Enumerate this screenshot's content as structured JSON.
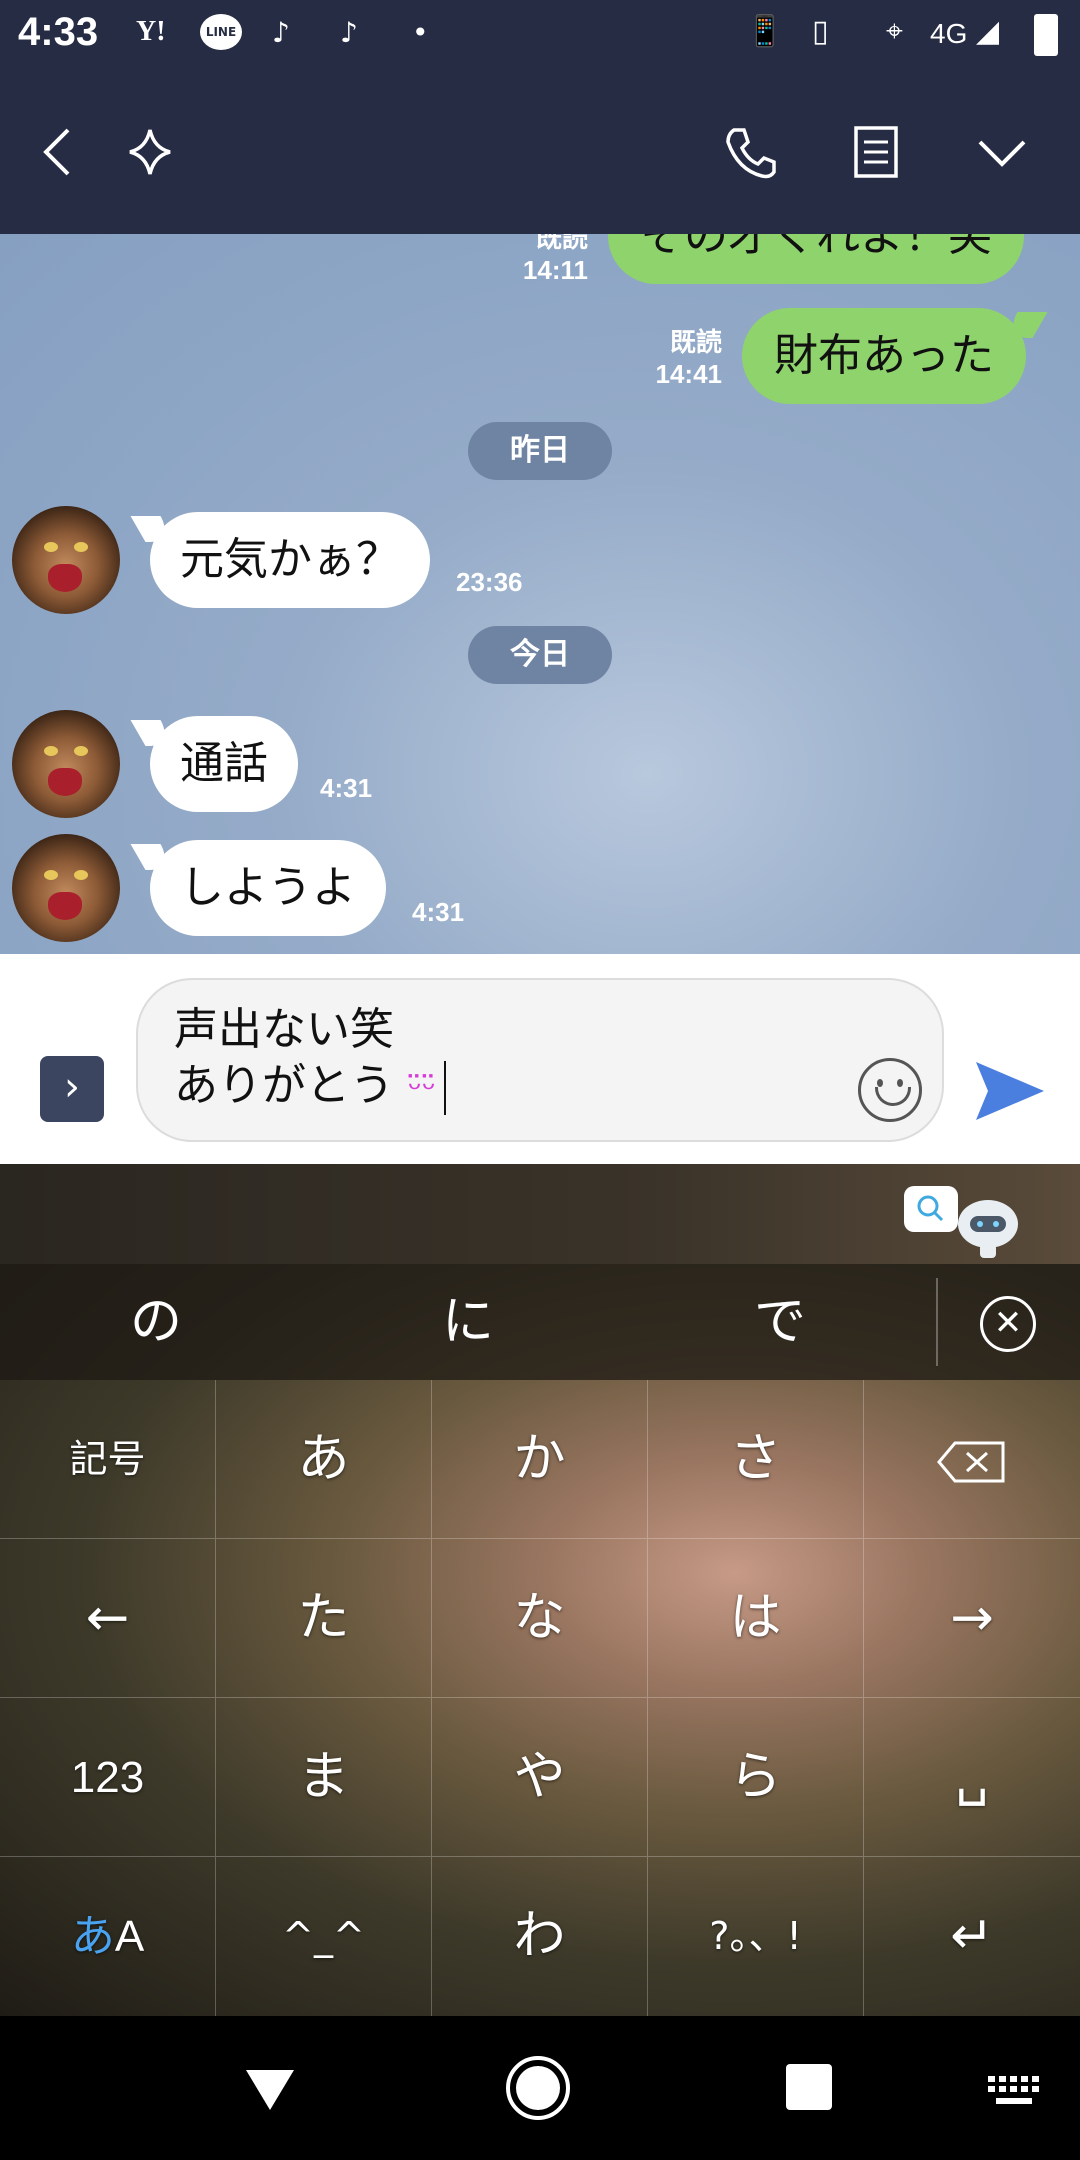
{
  "status_bar": {
    "time": "4:33",
    "left_icons": [
      "Y!",
      "LINE",
      "tiktok-icon",
      "tiktok-icon",
      "•"
    ],
    "network": "4G"
  },
  "header": {
    "back_icon": "chevron-left-icon",
    "star_icon": "sparkle-icon",
    "call_icon": "phone-icon",
    "notes_icon": "notes-icon",
    "menu_icon": "chevron-down-icon"
  },
  "messages": [
    {
      "side": "out",
      "text": "その才くれよ！笑",
      "read": "既読",
      "time": "14:11"
    },
    {
      "side": "out",
      "text": "財布あった",
      "read": "既読",
      "time": "14:41"
    },
    {
      "side": "divider",
      "text": "昨日"
    },
    {
      "side": "in",
      "text": "元気かぁ？",
      "time": "23:36"
    },
    {
      "side": "divider",
      "text": "今日"
    },
    {
      "side": "in",
      "text": "通話",
      "time": "4:31"
    },
    {
      "side": "in",
      "text": "しようよ",
      "time": "4:31"
    }
  ],
  "input": {
    "line1": "声出ない笑",
    "line2": "ありがとう",
    "emoticon": "ᵕ̈ᵕ̈"
  },
  "keyboard": {
    "suggestions": [
      "の",
      "に",
      "で"
    ],
    "rows": [
      [
        "記号",
        "あ",
        "か",
        "さ",
        "⌫"
      ],
      [
        "←",
        "た",
        "な",
        "は",
        "→"
      ],
      [
        "123",
        "ま",
        "や",
        "ら",
        "␣"
      ],
      [
        "あA",
        "^_^",
        "わ",
        "?。、!",
        "↵"
      ]
    ]
  },
  "colors": {
    "header_bg": "#252c43",
    "outgoing_bubble": "#8fd36d",
    "incoming_bubble": "#ffffff",
    "send_arrow": "#4a7fe0"
  }
}
